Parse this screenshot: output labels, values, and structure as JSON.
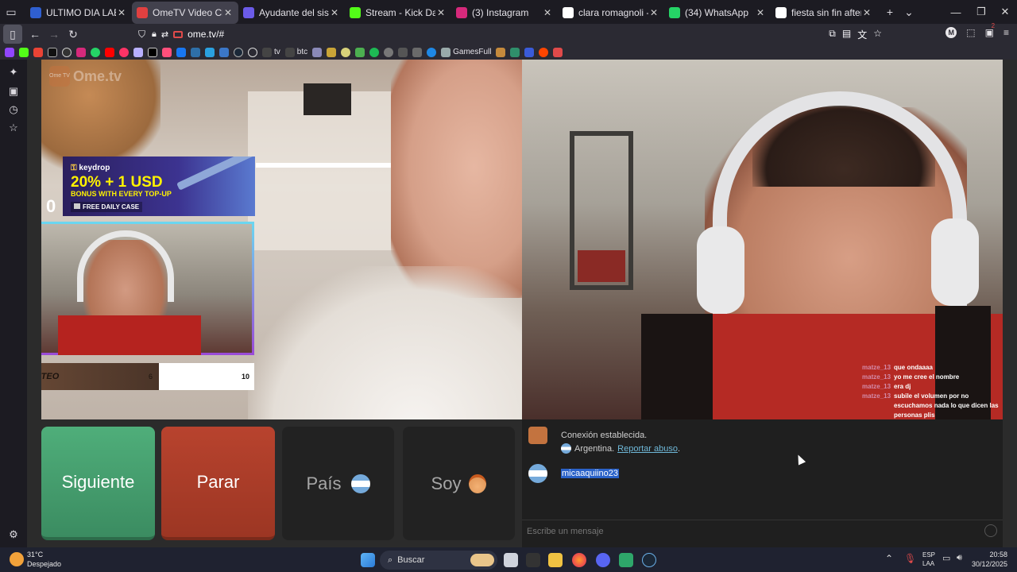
{
  "browser": {
    "tabs": [
      {
        "title": "ULTIMO DIA LABORAL , RE",
        "favicon_color": "#2f5fd0",
        "icon": "tab-favicon-icon"
      },
      {
        "title": "OmeTV Video Chat —",
        "favicon_color": "#e04040",
        "icon": "speaker-icon",
        "active": true
      },
      {
        "title": "Ayudante del sistema de D",
        "favicon_color": "#6b5be8",
        "icon": "tab-favicon-icon"
      },
      {
        "title": "Stream - Kick Dashboa",
        "favicon_color": "#53fc18",
        "icon": "kick-icon"
      },
      {
        "title": "(3) Instagram",
        "favicon_color": "#d6297b",
        "icon": "instagram-icon"
      },
      {
        "title": "clara romagnoli - Buscar co",
        "favicon_color": "#ffffff",
        "icon": "google-icon"
      },
      {
        "title": "(34) WhatsApp",
        "favicon_color": "#25d366",
        "icon": "whatsapp-icon"
      },
      {
        "title": "fiesta sin fin after monte g",
        "favicon_color": "#ffffff",
        "icon": "google-icon"
      }
    ],
    "url": "ome.tv/#",
    "bookmarks_label": "GamesFull",
    "tv_label": "tv",
    "btc_label": "btc",
    "ext_badge": "2"
  },
  "stream_overlay": {
    "logo_text": "Ome.tv",
    "logo_badge": "Ome TV",
    "ad_brand": "keydrop",
    "ad_headline": "20% + 1 USD",
    "ad_sub": "BONUS WITH EVERY TOP-UP",
    "ad_case": "FREE DAILY CASE",
    "twitch_count": "0",
    "sorteo_label": "SORTEO",
    "sorteo_current": "6",
    "sorteo_goal": "10"
  },
  "overlay_chat": [
    {
      "user": "matze_13",
      "text": "que ondaaaa"
    },
    {
      "user": "matze_13",
      "text": "yo me cree el nombre"
    },
    {
      "user": "matze_13",
      "text": "era dj"
    },
    {
      "user": "matze_13",
      "text": "subile el volumen por no escuchamos nada lo que dicen las personas plis"
    }
  ],
  "controls": {
    "next": "Siguiente",
    "stop": "Parar",
    "country": "País",
    "me": "Soy"
  },
  "chat": {
    "status": "Conexión establecida.",
    "country": "Argentina.",
    "report": "Reportar abuso",
    "report_suffix": ".",
    "partner_name": "micaaquiino23",
    "input_placeholder": "Escribe un mensaje"
  },
  "taskbar": {
    "weather_temp": "31°C",
    "weather_desc": "Despejado",
    "search": "Buscar",
    "lang": "ESP",
    "lang_sub": "LAA",
    "time": "20:58",
    "date": "30/12/2025"
  }
}
